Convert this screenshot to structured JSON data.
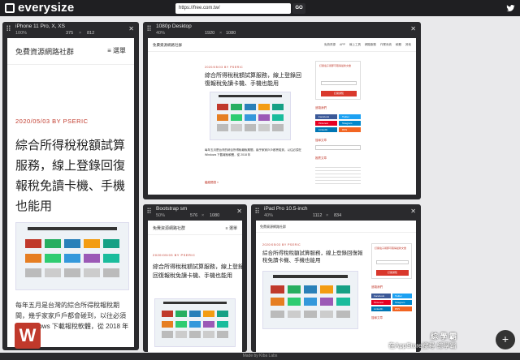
{
  "app": {
    "name": "everysize",
    "url": "https://free.com.tw/",
    "go_label": "GO",
    "footer": "Made by Kiba Labs"
  },
  "panels": [
    {
      "title": "iPhone 11 Pro, X, XS",
      "zoom": "100%",
      "width": "375",
      "height": "812"
    },
    {
      "title": "1080p Desktop",
      "zoom": "40%",
      "width": "1920",
      "height": "1080"
    },
    {
      "title": "Bootstrap sm",
      "zoom": "50%",
      "width": "576",
      "height": "1080"
    },
    {
      "title": "iPad Pro 10.5-inch",
      "zoom": "40%",
      "width": "1112",
      "height": "834"
    }
  ],
  "site": {
    "name": "免費資源網路社群",
    "menu_label": "選單",
    "date": "2020/05/03 BY PSERIC",
    "title": "綜合所得稅稅額試算服務，線上登錄回復報稅免讀卡機、手機也能用",
    "thumb_caption": "108 年度綜合所得稅結算申報",
    "body": "每年五月是台灣的綜合所得稅報稅期間，幾乎家家戶戶都會碰到，以往必須在 Windows 下載報稅軟體，從 2018 年",
    "read_more": "繼續閱讀 »"
  },
  "sidebar": {
    "subscribe_title": "訂閱電子報即可取得最新文章",
    "subscribe_button": "訂閱通知",
    "social_title": "追蹤我們",
    "social": [
      "Facebook",
      "Twitter",
      "Pinterest",
      "Telegram",
      "LinkedIn",
      "RSS"
    ],
    "social_colors": [
      "#3b5998",
      "#1da1f2",
      "#e60023",
      "#0088cc",
      "#0077b5",
      "#f26522"
    ],
    "search_title": "搜尋文章",
    "recommend_title": "推薦文章"
  },
  "desktop_nav": [
    "免費資源",
    "APP",
    "線上工具",
    "網路服務",
    "作業系統",
    "軟體",
    "其他"
  ],
  "overlay": {
    "watermark_logo": "W",
    "watermark_caption": "綜 學 霸",
    "watermark_sub": "在AppStore搜尋 綜學霸"
  },
  "colors": {
    "accent": "#d9382c",
    "dark": "#2a2a2d"
  }
}
